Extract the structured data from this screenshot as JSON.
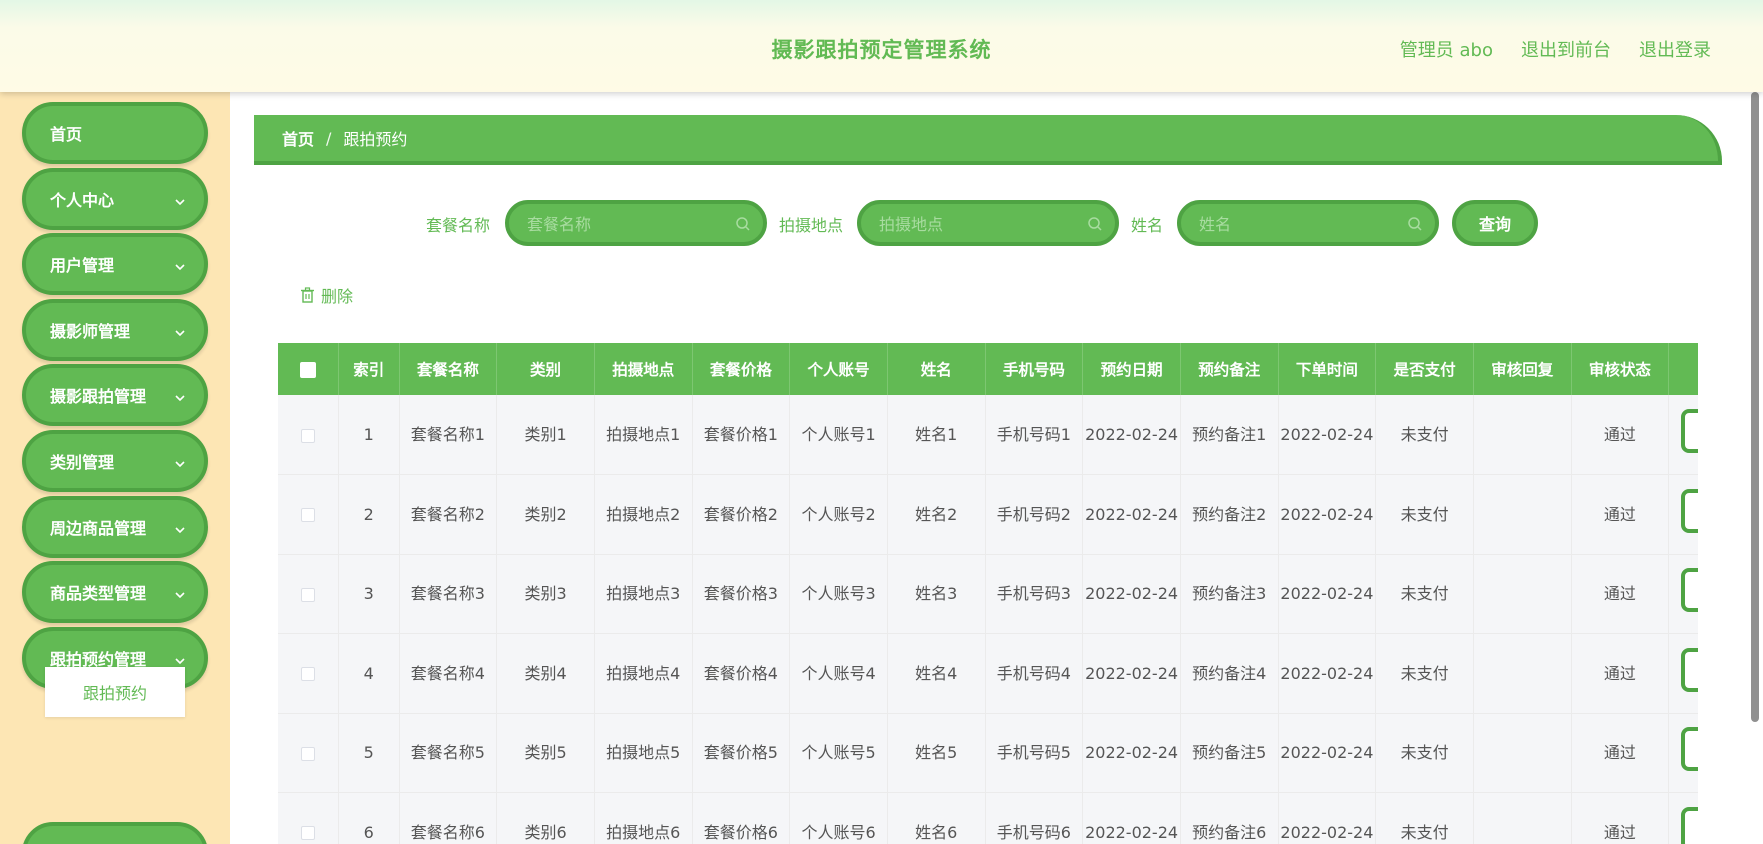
{
  "header": {
    "title": "摄影跟拍预定管理系统",
    "admin": "管理员 abo",
    "front": "退出到前台",
    "logout": "退出登录"
  },
  "sidebar": {
    "items": [
      {
        "label": "首页",
        "expandable": false
      },
      {
        "label": "个人中心",
        "expandable": true
      },
      {
        "label": "用户管理",
        "expandable": true
      },
      {
        "label": "摄影师管理",
        "expandable": true
      },
      {
        "label": "摄影跟拍管理",
        "expandable": true
      },
      {
        "label": "类别管理",
        "expandable": true
      },
      {
        "label": "周边商品管理",
        "expandable": true
      },
      {
        "label": "商品类型管理",
        "expandable": true
      },
      {
        "label": "跟拍预约管理",
        "expandable": true
      }
    ],
    "sub_item": "跟拍预约"
  },
  "breadcrumb": {
    "home": "首页",
    "sep": "/",
    "current": "跟拍预约"
  },
  "search": {
    "package_label": "套餐名称",
    "package_placeholder": "套餐名称",
    "location_label": "拍摄地点",
    "location_placeholder": "拍摄地点",
    "name_label": "姓名",
    "name_placeholder": "姓名",
    "query": "查询"
  },
  "toolbar": {
    "delete": "删除"
  },
  "table": {
    "columns": [
      "索引",
      "套餐名称",
      "类别",
      "拍摄地点",
      "套餐价格",
      "个人账号",
      "姓名",
      "手机号码",
      "预约日期",
      "预约备注",
      "下单时间",
      "是否支付",
      "审核回复",
      "审核状态"
    ],
    "rows": [
      {
        "index": "1",
        "package": "套餐名称1",
        "category": "类别1",
        "location": "拍摄地点1",
        "price": "套餐价格1",
        "account": "个人账号1",
        "name": "姓名1",
        "phone": "手机号码1",
        "date": "2022-02-24",
        "note": "预约备注1",
        "order_time": "2022-02-24",
        "paid": "未支付",
        "reply": "",
        "status": "通过"
      },
      {
        "index": "2",
        "package": "套餐名称2",
        "category": "类别2",
        "location": "拍摄地点2",
        "price": "套餐价格2",
        "account": "个人账号2",
        "name": "姓名2",
        "phone": "手机号码2",
        "date": "2022-02-24",
        "note": "预约备注2",
        "order_time": "2022-02-24",
        "paid": "未支付",
        "reply": "",
        "status": "通过"
      },
      {
        "index": "3",
        "package": "套餐名称3",
        "category": "类别3",
        "location": "拍摄地点3",
        "price": "套餐价格3",
        "account": "个人账号3",
        "name": "姓名3",
        "phone": "手机号码3",
        "date": "2022-02-24",
        "note": "预约备注3",
        "order_time": "2022-02-24",
        "paid": "未支付",
        "reply": "",
        "status": "通过"
      },
      {
        "index": "4",
        "package": "套餐名称4",
        "category": "类别4",
        "location": "拍摄地点4",
        "price": "套餐价格4",
        "account": "个人账号4",
        "name": "姓名4",
        "phone": "手机号码4",
        "date": "2022-02-24",
        "note": "预约备注4",
        "order_time": "2022-02-24",
        "paid": "未支付",
        "reply": "",
        "status": "通过"
      },
      {
        "index": "5",
        "package": "套餐名称5",
        "category": "类别5",
        "location": "拍摄地点5",
        "price": "套餐价格5",
        "account": "个人账号5",
        "name": "姓名5",
        "phone": "手机号码5",
        "date": "2022-02-24",
        "note": "预约备注5",
        "order_time": "2022-02-24",
        "paid": "未支付",
        "reply": "",
        "status": "通过"
      },
      {
        "index": "6",
        "package": "套餐名称6",
        "category": "类别6",
        "location": "拍摄地点6",
        "price": "套餐价格6",
        "account": "个人账号6",
        "name": "姓名6",
        "phone": "手机号码6",
        "date": "2022-02-24",
        "note": "预约备注6",
        "order_time": "2022-02-24",
        "paid": "未支付",
        "reply": "",
        "status": "通过"
      }
    ]
  },
  "colors": {
    "primary": "#62ba54",
    "primary_dark": "#4ea343",
    "sidebar_bg": "#fde6b4"
  }
}
